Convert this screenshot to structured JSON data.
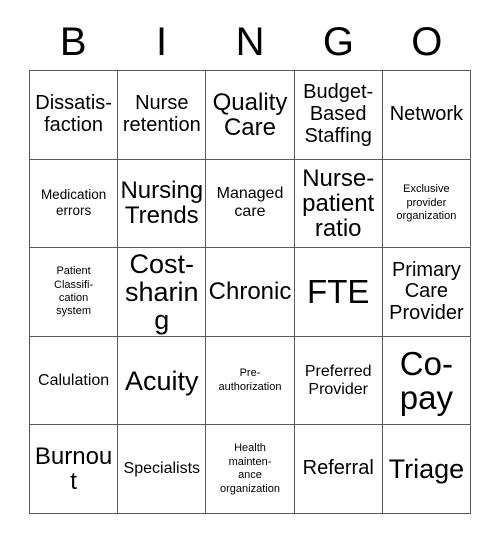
{
  "header": {
    "letters": [
      "B",
      "I",
      "N",
      "G",
      "O"
    ]
  },
  "grid": {
    "rows": 5,
    "columns": 5,
    "border_color": "#595959",
    "background_color": "#ffffff",
    "text_color": "#000000",
    "cells": [
      {
        "text": "Dissatis-\nfaction",
        "size": "l"
      },
      {
        "text": "Nurse\nretention",
        "size": "l"
      },
      {
        "text": "Quality\nCare",
        "size": "xl"
      },
      {
        "text": "Budget-\nBased\nStaffing",
        "size": "l"
      },
      {
        "text": "Network",
        "size": "l"
      },
      {
        "text": "Medication\nerrors",
        "size": "s"
      },
      {
        "text": "Nursing\nTrends",
        "size": "xl"
      },
      {
        "text": "Managed\ncare",
        "size": "m"
      },
      {
        "text": "Nurse-\npatient\nratio",
        "size": "xl"
      },
      {
        "text": "Exclusive\nprovider\norganization",
        "size": "xs"
      },
      {
        "text": "Patient\nClassifi-\ncation\nsystem",
        "size": "xs"
      },
      {
        "text": "Cost-\nsharing",
        "size": "xxl"
      },
      {
        "text": "Chronic",
        "size": "xl"
      },
      {
        "text": "FTE",
        "size": "3xl"
      },
      {
        "text": "Primary\nCare\nProvider",
        "size": "l"
      },
      {
        "text": "Calulation",
        "size": "m"
      },
      {
        "text": "Acuity",
        "size": "xxl"
      },
      {
        "text": "Pre-\nauthorization",
        "size": "xs"
      },
      {
        "text": "Preferred\nProvider",
        "size": "m"
      },
      {
        "text": "Co-\npay",
        "size": "3xl"
      },
      {
        "text": "Burnout",
        "size": "xl"
      },
      {
        "text": "Specialists",
        "size": "m"
      },
      {
        "text": "Health\nmainten-\nance\norganization",
        "size": "xs"
      },
      {
        "text": "Referral",
        "size": "l"
      },
      {
        "text": "Triage",
        "size": "xxl"
      }
    ]
  }
}
